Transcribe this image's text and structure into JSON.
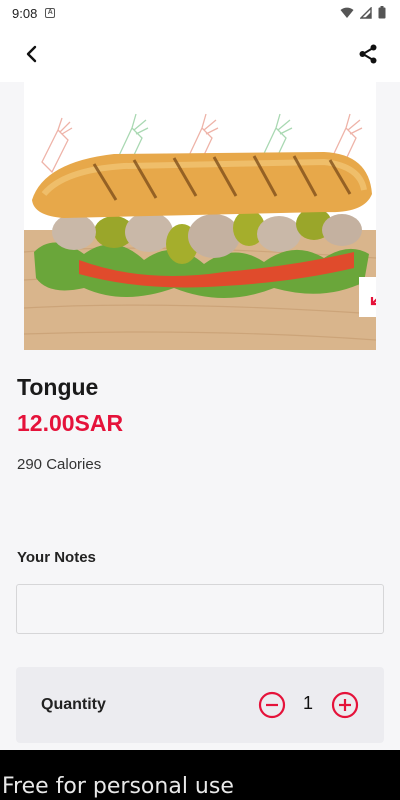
{
  "status_bar": {
    "time": "9:08",
    "notification_icon": "a-box-icon"
  },
  "app_bar": {
    "back_icon": "chevron-left-icon",
    "share_icon": "share-icon"
  },
  "product": {
    "name": "Tongue",
    "price": "12.00SAR",
    "calories": "290 Calories",
    "image": "sandwich-photo"
  },
  "notes": {
    "label": "Your Notes",
    "value": "",
    "placeholder": ""
  },
  "quantity": {
    "label": "Quantity",
    "value": "1"
  },
  "colors": {
    "accent": "#e5123a",
    "background": "#f6f6f8",
    "card": "#ececf0"
  },
  "watermark": {
    "text": "Free for personal use"
  }
}
